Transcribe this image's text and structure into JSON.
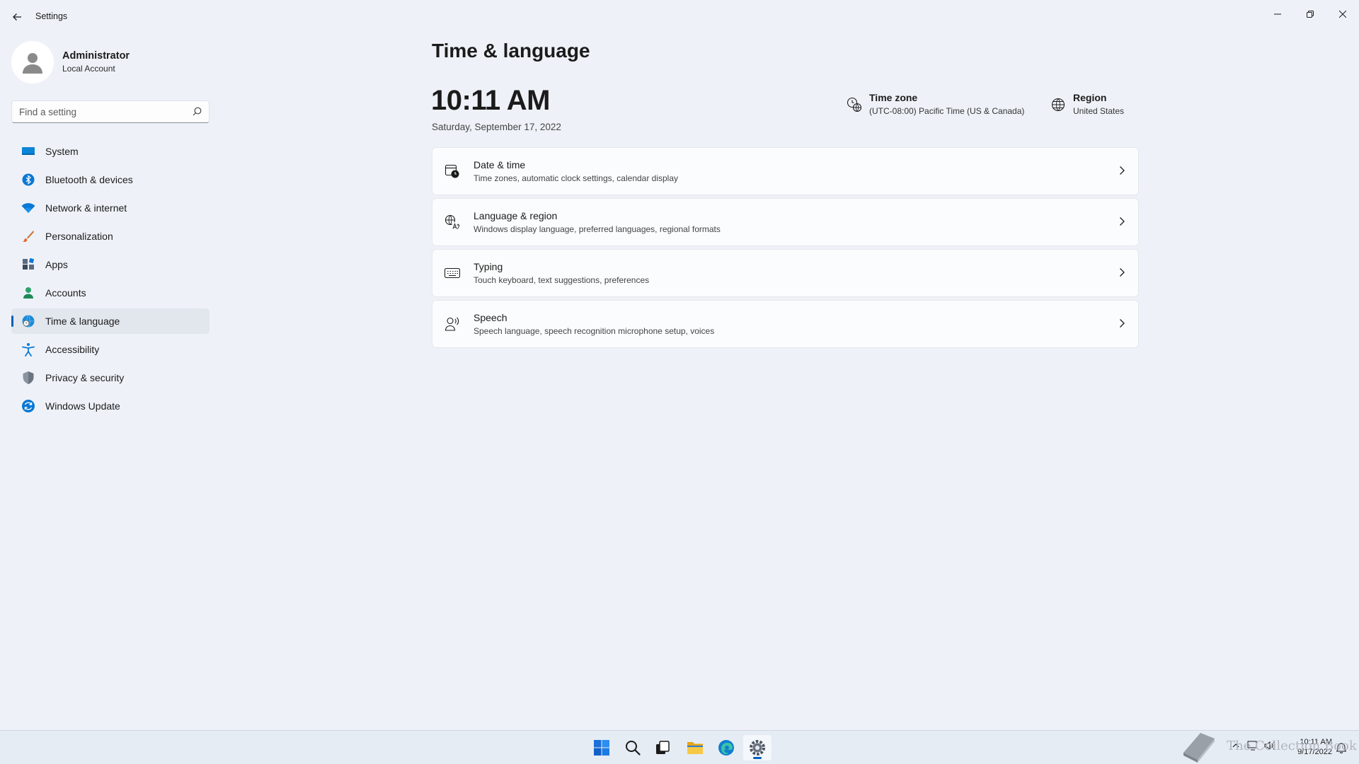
{
  "window": {
    "title": "Settings"
  },
  "profile": {
    "name": "Administrator",
    "account_type": "Local Account"
  },
  "search": {
    "placeholder": "Find a setting"
  },
  "sidebar": {
    "items": [
      {
        "label": "System",
        "icon": "system-icon"
      },
      {
        "label": "Bluetooth & devices",
        "icon": "bluetooth-icon"
      },
      {
        "label": "Network & internet",
        "icon": "wifi-icon"
      },
      {
        "label": "Personalization",
        "icon": "brush-icon"
      },
      {
        "label": "Apps",
        "icon": "apps-icon"
      },
      {
        "label": "Accounts",
        "icon": "person-icon"
      },
      {
        "label": "Time & language",
        "icon": "globe-clock-icon",
        "active": true
      },
      {
        "label": "Accessibility",
        "icon": "accessibility-icon"
      },
      {
        "label": "Privacy & security",
        "icon": "shield-icon"
      },
      {
        "label": "Windows Update",
        "icon": "update-icon"
      }
    ]
  },
  "main": {
    "title": "Time & language",
    "clock": "10:11 AM",
    "date": "Saturday, September 17, 2022",
    "time_zone": {
      "title": "Time zone",
      "value": "(UTC-08:00) Pacific Time (US & Canada)"
    },
    "region": {
      "title": "Region",
      "value": "United States"
    },
    "cards": [
      {
        "title": "Date & time",
        "desc": "Time zones, automatic clock settings, calendar display",
        "icon": "calendar-clock-icon"
      },
      {
        "title": "Language & region",
        "desc": "Windows display language, preferred languages, regional formats",
        "icon": "language-icon"
      },
      {
        "title": "Typing",
        "desc": "Touch keyboard, text suggestions, preferences",
        "icon": "keyboard-icon"
      },
      {
        "title": "Speech",
        "desc": "Speech language, speech recognition microphone setup, voices",
        "icon": "speech-icon"
      }
    ]
  },
  "taskbar": {
    "apps": [
      "start-icon",
      "search-icon",
      "task-view-icon",
      "file-explorer-icon",
      "edge-icon",
      "settings-icon"
    ],
    "active_app": "settings-icon",
    "tray_time": "10:11 AM",
    "tray_date": "9/17/2022",
    "watermark_text": "The Collection Book"
  },
  "colors": {
    "accent": "#005fb8",
    "background": "#eef2f8",
    "card": "#fbfcfd"
  }
}
